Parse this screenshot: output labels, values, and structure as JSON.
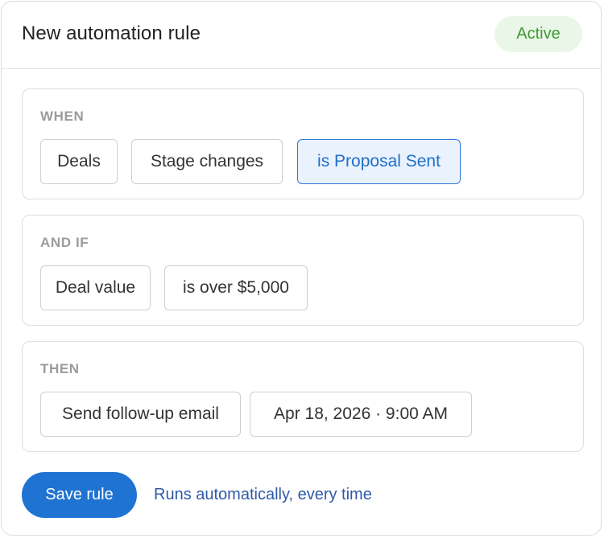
{
  "header": {
    "title": "New automation rule",
    "status_badge": "Active"
  },
  "sections": [
    {
      "label": "WHEN",
      "chips": [
        "Deals",
        "Stage changes",
        "is Proposal Sent"
      ]
    },
    {
      "label": "AND IF",
      "chips": [
        "Deal value",
        "is over $5,000"
      ]
    },
    {
      "label": "THEN",
      "chips": [
        "Send follow-up email",
        "Apr 18, 2026 · 9:00 AM"
      ]
    }
  ],
  "footer": {
    "save_label": "Save rule",
    "note": "Runs automatically, every time"
  },
  "colors": {
    "accent": "#1f73d2",
    "active_badge_bg": "#eaf6e7",
    "active_badge_text": "#3f9a35",
    "selected_chip_bg": "#eaf2fd",
    "selected_chip_border": "#2a7ad6"
  }
}
